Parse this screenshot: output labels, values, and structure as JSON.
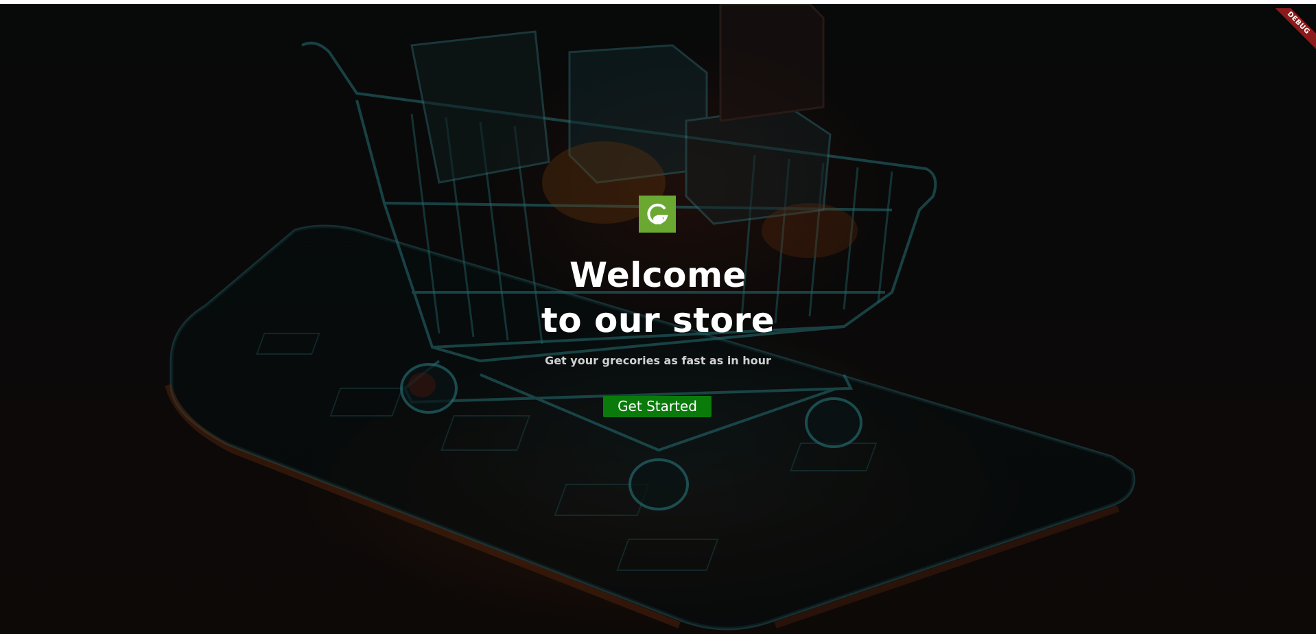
{
  "app": {
    "debug_banner": "DEBUG"
  },
  "hero": {
    "logo_icon": "grocery-g-logo-icon",
    "title_line1": "Welcome",
    "title_line2": "to our store",
    "subtitle": "Get your grecories as fast as in hour",
    "cta_label": "Get Started"
  },
  "colors": {
    "logo_bg": "#6aa832",
    "cta_bg": "#0a7a0a",
    "title": "#ffffff",
    "subtitle": "#cfd2d3",
    "debug_banner": "#8b1a1a"
  }
}
